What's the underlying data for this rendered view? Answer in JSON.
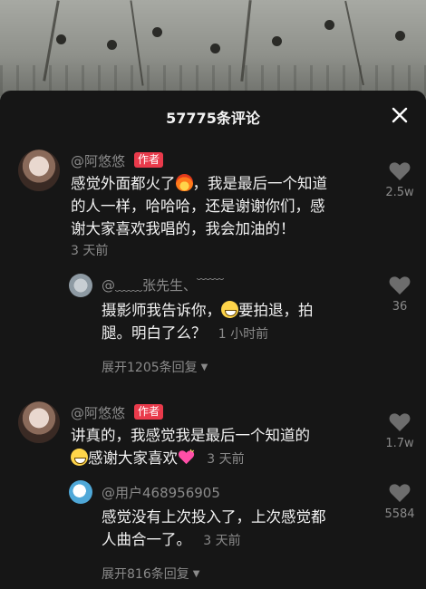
{
  "header": {
    "title": "57775条评论"
  },
  "icons": {
    "close": "close-icon",
    "like": "heart-outline-icon",
    "expand_caret": "caret-down-icon"
  },
  "colors": {
    "panel_bg": "#161616",
    "author_badge": "#e93a4b",
    "muted_text": "#8a8a8a"
  },
  "comments": [
    {
      "username": "@阿悠悠",
      "badge": "作者",
      "text_part1": "感觉外面都火了",
      "text_part2": "，我是最后一个知道",
      "text_line2": "的人一样，哈哈哈，还是谢谢你们，感",
      "text_line3": "谢大家喜欢我唱的，我会加油的！",
      "time": "3 天前",
      "likes": "2.5w",
      "replies": [
        {
          "username": "@﹏﹏张先生、﹋﹋ ",
          "text_part1": "摄影师我告诉你，",
          "text_part2": "要拍退，拍",
          "text_line2": "腿。明白了么？",
          "time": "1 小时前",
          "likes": "36"
        }
      ],
      "expand_label": "展开1205条回复"
    },
    {
      "username": "@阿悠悠",
      "badge": "作者",
      "text_line1": "讲真的，我感觉我是最后一个知道的",
      "text_part2": "感谢大家喜欢",
      "time": "3 天前",
      "likes": "1.7w",
      "replies": [
        {
          "username": "@用户468956905",
          "text_line1": "感觉没有上次投入了，上次感觉都",
          "text_line2": "人曲合一了。",
          "time": "3 天前",
          "likes": "5584"
        }
      ],
      "expand_label": "展开816条回复"
    }
  ]
}
